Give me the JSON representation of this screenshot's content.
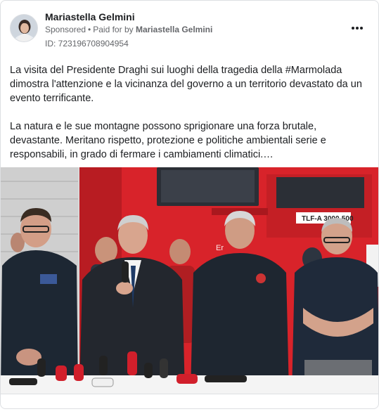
{
  "post": {
    "author": "Mariastella Gelmini",
    "sponsored_label": "Sponsored",
    "separator": "•",
    "paid_for_prefix": "Paid for by",
    "paid_for_name": "Mariastella Gelmini",
    "ad_id": "ID: 723196708904954",
    "paragraph_1": "La visita del Presidente Draghi sui luoghi della tragedia della #Marmolada dimostra l'attenzione e la vicinanza del governo a un territorio devastato da un evento terrificante.",
    "paragraph_2": "La natura e le sue montagne possono sprigionare una forza brutale, devastante. Meritano rispetto, protezione e politiche ambientali serie e responsabili, in grado di fermare i cambiamenti climatici.…",
    "photo": {
      "truck_label": "TLF-A 3000-500",
      "truck_partial_text": "Er"
    }
  },
  "icons": {
    "more": "more-horizontal-icon"
  },
  "colors": {
    "truck_red": "#d8232a",
    "text_primary": "#1c1e21",
    "text_secondary": "#65676b",
    "card_border": "#dddfe2"
  }
}
